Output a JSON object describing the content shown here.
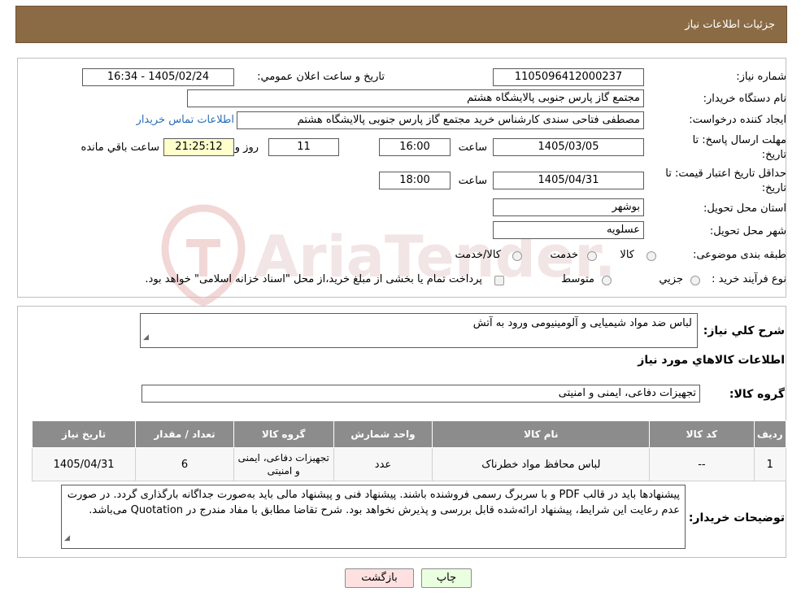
{
  "header": {
    "title": "جزئیات اطلاعات نیاز"
  },
  "fields": {
    "need_number": {
      "label": "شماره نیاز:",
      "value": "1105096412000237"
    },
    "announce_datetime": {
      "label": "تاريخ و ساعت اعلان عمومي:",
      "value": "1405/02/24 - 16:34"
    },
    "buyer_org": {
      "label": "نام دستگاه خريدار:",
      "value": "مجتمع گاز پارس جنوبی  پالایشگاه هشتم"
    },
    "requester": {
      "label": "ايجاد کننده درخواست:",
      "value": "مصطفی فتاحی سندی کارشناس خرید مجتمع گاز پارس جنوبی  پالایشگاه هشتم",
      "contact_link": "اطلاعات تماس خريدار"
    },
    "reply_deadline": {
      "label_line1": "مهلت ارسال پاسخ: تا",
      "label_line2": "تاريخ:",
      "date": "1405/03/05",
      "time_label": "ساعت",
      "time": "16:00",
      "days": "11",
      "days_label": "روز و",
      "remaining": "21:25:12",
      "remaining_label": "ساعت باقي مانده"
    },
    "price_validity": {
      "label_line1": "حداقل تاريخ اعتبار قيمت: تا",
      "label_line2": "تاريخ:",
      "date": "1405/04/31",
      "time_label": "ساعت",
      "time": "18:00"
    },
    "province": {
      "label": "استان محل تحويل:",
      "value": "بوشهر"
    },
    "city": {
      "label": "شهر محل تحويل:",
      "value": "عسلویه"
    },
    "category": {
      "label": "طبقه بندی موضوعی:",
      "options": [
        "کالا",
        "خدمت",
        "کالا/خدمت"
      ]
    },
    "purchase_process": {
      "label": "نوع فرآيند خريد :",
      "options": [
        "جزيي",
        "متوسط"
      ],
      "note": "پرداخت تمام يا بخشی از مبلغ خريد،از محل \"اسناد خزانه اسلامی\" خواهد بود."
    }
  },
  "summary": {
    "label": "شرح کلي نياز:",
    "value": "لباس ضد مواد شیمیایی و آلومینیومی ورود به آتش"
  },
  "goods_section_title": "اطلاعات کالاهاي مورد نياز",
  "goods_group": {
    "label": "گروه کالا:",
    "value": "تجهیزات دفاعی، ایمنی و امنیتی"
  },
  "table": {
    "headers": [
      "رديف",
      "کد کالا",
      "نام کالا",
      "واحد شمارش",
      "گروه کالا",
      "تعداد / مقدار",
      "تاريخ نياز"
    ],
    "rows": [
      [
        "1",
        "--",
        "لباس محافظ مواد خطرناک",
        "عدد",
        "تجهیزات دفاعی، ایمنی و امنیتی",
        "6",
        "1405/04/31"
      ]
    ]
  },
  "buyer_notes": {
    "label": "توضيحات خريدار:",
    "value": "پیشنهادها باید در قالب PDF و با سربرگ رسمی فروشنده باشند. پیشنهاد فنی و پیشنهاد مالی باید به‌صورت جداگانه بارگذاری گردد. در صورت عدم رعایت این شرایط، پیشنهاد ارائه‌شده قابل بررسی و پذیرش نخواهد بود. شرح تقاضا مطابق با مفاد مندرج در Quotation می‌باشد."
  },
  "buttons": {
    "print": "چاپ",
    "back": "بازگشت"
  },
  "watermark": "AriaTender.neT",
  "colors": {
    "header_bg": "#8b6b45",
    "print_btn": "#eaffe0",
    "back_btn": "#ffe0e0",
    "table_header": "#8c8c8c",
    "link": "#2a6fb4"
  }
}
